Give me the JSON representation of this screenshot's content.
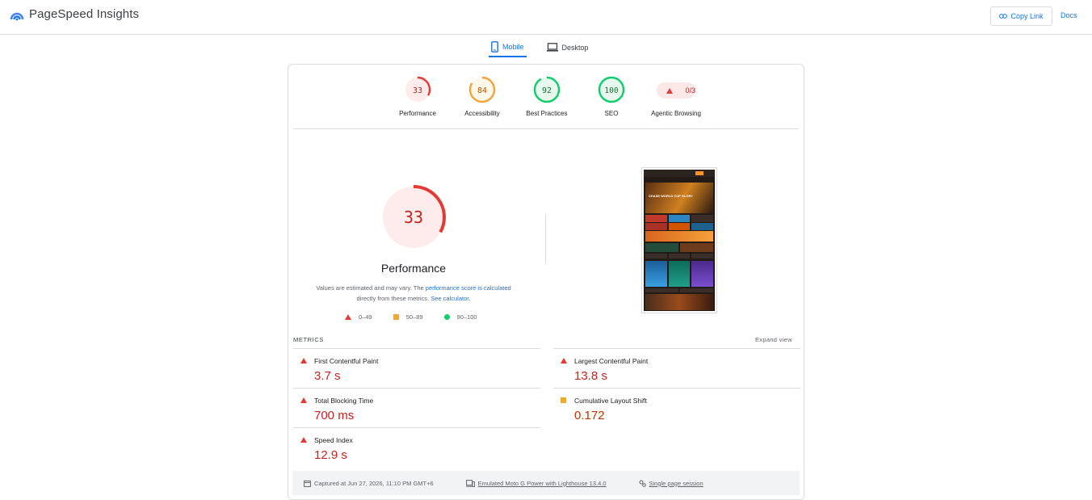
{
  "header": {
    "title": "PageSpeed Insights",
    "copy_link_label": "Copy Link",
    "docs_label": "Docs"
  },
  "tabs": [
    {
      "label": "Mobile",
      "active": true
    },
    {
      "label": "Desktop",
      "active": false
    }
  ],
  "scores": [
    {
      "label": "Performance",
      "score": "33",
      "value": 33,
      "color": "#e53935"
    },
    {
      "label": "Accessibility",
      "score": "84",
      "value": 84,
      "color": "#f2a53a"
    },
    {
      "label": "Best Practices",
      "score": "92",
      "value": 92,
      "color": "#0cce6b"
    },
    {
      "label": "SEO",
      "score": "100",
      "value": 100,
      "color": "#0cce6b"
    }
  ],
  "agentic": {
    "label": "Agentic Browsing",
    "score": "0/3"
  },
  "performance": {
    "score": "33",
    "value": 33,
    "title": "Performance",
    "note_1": "Values are estimated and may vary. The ",
    "note_link_1": "performance score is calculated",
    "note_2": "directly from these metrics. ",
    "note_link_2": "See calculator",
    "note_3": "."
  },
  "legend": [
    {
      "label": "0–49",
      "shape": "triangle",
      "color": "#e53935"
    },
    {
      "label": "50–89",
      "shape": "square",
      "color": "#f2a53a"
    },
    {
      "label": "90–100",
      "shape": "circle",
      "color": "#0cce6b"
    }
  ],
  "metrics": {
    "heading": "METRICS",
    "expand_label": "Expand view",
    "items": [
      {
        "name": "First Contentful Paint",
        "value": "3.7 s",
        "status": "red"
      },
      {
        "name": "Largest Contentful Paint",
        "value": "13.8 s",
        "status": "red"
      },
      {
        "name": "Total Blocking Time",
        "value": "700 ms",
        "status": "red"
      },
      {
        "name": "Cumulative Layout Shift",
        "value": "0.172",
        "status": "orange"
      },
      {
        "name": "Speed Index",
        "value": "12.9 s",
        "status": "red"
      }
    ]
  },
  "footer": {
    "captured": "Captured at Jun 27, 2026, 11:10 PM GMT+6",
    "device": "Emulated Moto G Power with Lighthouse 13.4.0",
    "session": "Single page session"
  },
  "preview": {
    "hero_text": "CHASE WORLD CUP GLORY"
  },
  "icons": {
    "brand": "pagespeed-logo-icon",
    "copy": "link-icon",
    "mobile": "mobile-phone-icon",
    "desktop": "laptop-icon",
    "calendar": "calendar-icon",
    "device": "device-icon",
    "session": "session-icon"
  }
}
